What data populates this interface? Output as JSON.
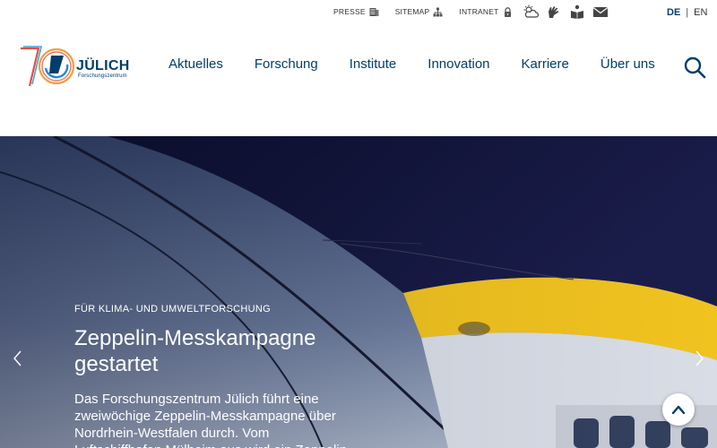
{
  "utility": {
    "links": [
      {
        "label": "PRESSE",
        "icon": "press-icon"
      },
      {
        "label": "SITEMAP",
        "icon": "sitemap-icon"
      },
      {
        "label": "INTRANET",
        "icon": "lock-icon"
      }
    ],
    "accessibility_icons": [
      "weather-icon",
      "sign-language-icon",
      "easy-language-icon",
      "mail-icon"
    ]
  },
  "language": {
    "active": "DE",
    "separator": "|",
    "other": "EN"
  },
  "logo": {
    "number": "70",
    "brand": "JÜLICH",
    "subtitle": "Forschungszentrum"
  },
  "nav": {
    "items": [
      "Aktuelles",
      "Forschung",
      "Institute",
      "Innovation",
      "Karriere",
      "Über uns"
    ]
  },
  "hero": {
    "kicker": "FÜR KLIMA- UND UMWELTFORSCHUNG",
    "headline": "Zeppelin-Messkampagne gestartet",
    "teaser": "Das Forschungszentrum Jülich führt eine zweiwöchige Zeppelin-Messkampagne über Nordrhein-Westfalen durch. Vom Luftschiffhafen Mülheim aus wird ein Zeppelin"
  },
  "colors": {
    "brand": "#023d6b",
    "logo_red": "#e0504a",
    "logo_orange": "#f2a13a",
    "logo_blue": "#1f8ad2",
    "zeppelin_yellow": "#f1c31f"
  }
}
